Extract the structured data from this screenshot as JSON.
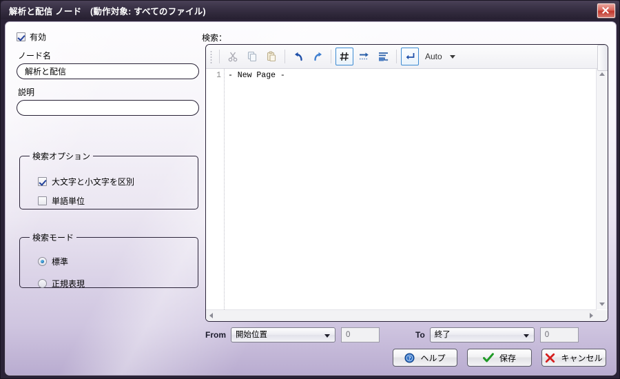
{
  "window": {
    "title": "解析と配信 ノード　(動作対象: すべてのファイル)",
    "close_icon": "close-icon"
  },
  "left_panel": {
    "enabled_checkbox": {
      "label": "有効",
      "checked": true
    },
    "node_name": {
      "label": "ノード名",
      "value": "解析と配信",
      "placeholder": ""
    },
    "description": {
      "label": "説明",
      "value": "",
      "placeholder": ""
    },
    "search_options": {
      "legend": "検索オプション",
      "items": [
        {
          "label": "大文字と小文字を区別",
          "checked": true
        },
        {
          "label": "単語単位",
          "checked": false
        }
      ]
    },
    "search_mode": {
      "legend": "検索モード",
      "items": [
        {
          "label": "標準",
          "selected": true
        },
        {
          "label": "正規表現",
          "selected": false
        }
      ]
    }
  },
  "right_panel": {
    "search_label": "検索：",
    "toolbar": {
      "buttons": [
        {
          "name": "cut-icon",
          "title": "切り取り",
          "active": false,
          "enabled": false
        },
        {
          "name": "copy-icon",
          "title": "コピー",
          "active": false,
          "enabled": false
        },
        {
          "name": "paste-icon",
          "title": "貼り付け",
          "active": false,
          "enabled": false
        },
        {
          "name": "undo-icon",
          "title": "元に戻す",
          "active": false,
          "enabled": true
        },
        {
          "name": "redo-icon",
          "title": "やり直し",
          "active": false,
          "enabled": true
        },
        {
          "name": "line-numbers-icon",
          "title": "#",
          "active": true,
          "enabled": true
        },
        {
          "name": "show-tabs-icon",
          "title": "タブ表示",
          "active": false,
          "enabled": true
        },
        {
          "name": "word-wrap-icon",
          "title": "折り返し",
          "active": false,
          "enabled": true
        },
        {
          "name": "show-newline-icon",
          "title": "改行表示",
          "active": true,
          "enabled": true
        }
      ],
      "encoding_label": "Auto",
      "encoding_caret": "chevron-down-icon"
    },
    "editor": {
      "lines": [
        {
          "number": "1",
          "text": "- New Page -"
        }
      ]
    }
  },
  "range": {
    "from_label": "From",
    "from_value": "開始位置",
    "from_number": "0",
    "to_label": "To",
    "to_value": "終了",
    "to_number": "0"
  },
  "footer": {
    "help_label": "ヘルプ",
    "save_label": "保存",
    "cancel_label": "キャンセル",
    "help_icon": "help-icon",
    "save_icon": "check-icon",
    "cancel_icon": "cross-icon"
  },
  "colors": {
    "titlebar": "#3b3348",
    "accent_blue": "#21409a",
    "active_border": "#3c8ad2",
    "close_red": "#c0362c",
    "save_green": "#1e9a26",
    "cancel_red": "#d51f1f",
    "panel_gradient_top": "#fdfcfe",
    "panel_gradient_bottom": "#b9acd0"
  }
}
